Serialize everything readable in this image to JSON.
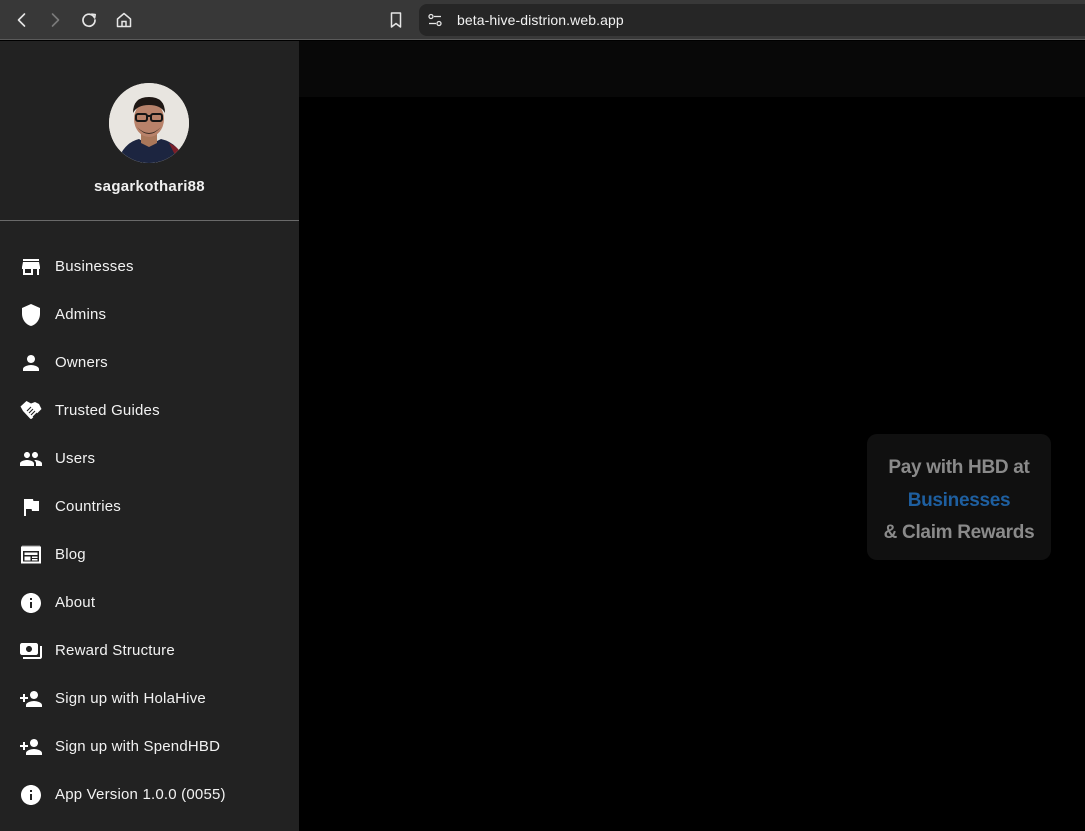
{
  "browser": {
    "url": "beta-hive-distrion.web.app",
    "icons": [
      "back-icon",
      "forward-icon",
      "reload-icon",
      "home-icon",
      "bookmark-icon",
      "site-settings-icon"
    ]
  },
  "profile": {
    "username": "sagarkothari88"
  },
  "menu": {
    "items": [
      {
        "label": "Businesses",
        "icon": "store-icon"
      },
      {
        "label": "Admins",
        "icon": "shield-icon"
      },
      {
        "label": "Owners",
        "icon": "person-icon"
      },
      {
        "label": "Trusted Guides",
        "icon": "handshake-icon"
      },
      {
        "label": "Users",
        "icon": "people-icon"
      },
      {
        "label": "Countries",
        "icon": "flag-icon"
      },
      {
        "label": "Blog",
        "icon": "newspaper-icon"
      },
      {
        "label": "About",
        "icon": "info-icon"
      },
      {
        "label": "Reward Structure",
        "icon": "payments-icon"
      },
      {
        "label": "Sign up with HolaHive",
        "icon": "person-add-icon"
      },
      {
        "label": "Sign up with SpendHBD",
        "icon": "person-add-icon"
      },
      {
        "label": "App Version 1.0.0 (0055)",
        "icon": "info-icon"
      }
    ]
  },
  "promo": {
    "line1": "Pay with HBD at",
    "link": "Businesses",
    "line3": "& Claim Rewards",
    "colors": {
      "text": "#8a8a8a",
      "link": "#1e5fa0"
    }
  }
}
